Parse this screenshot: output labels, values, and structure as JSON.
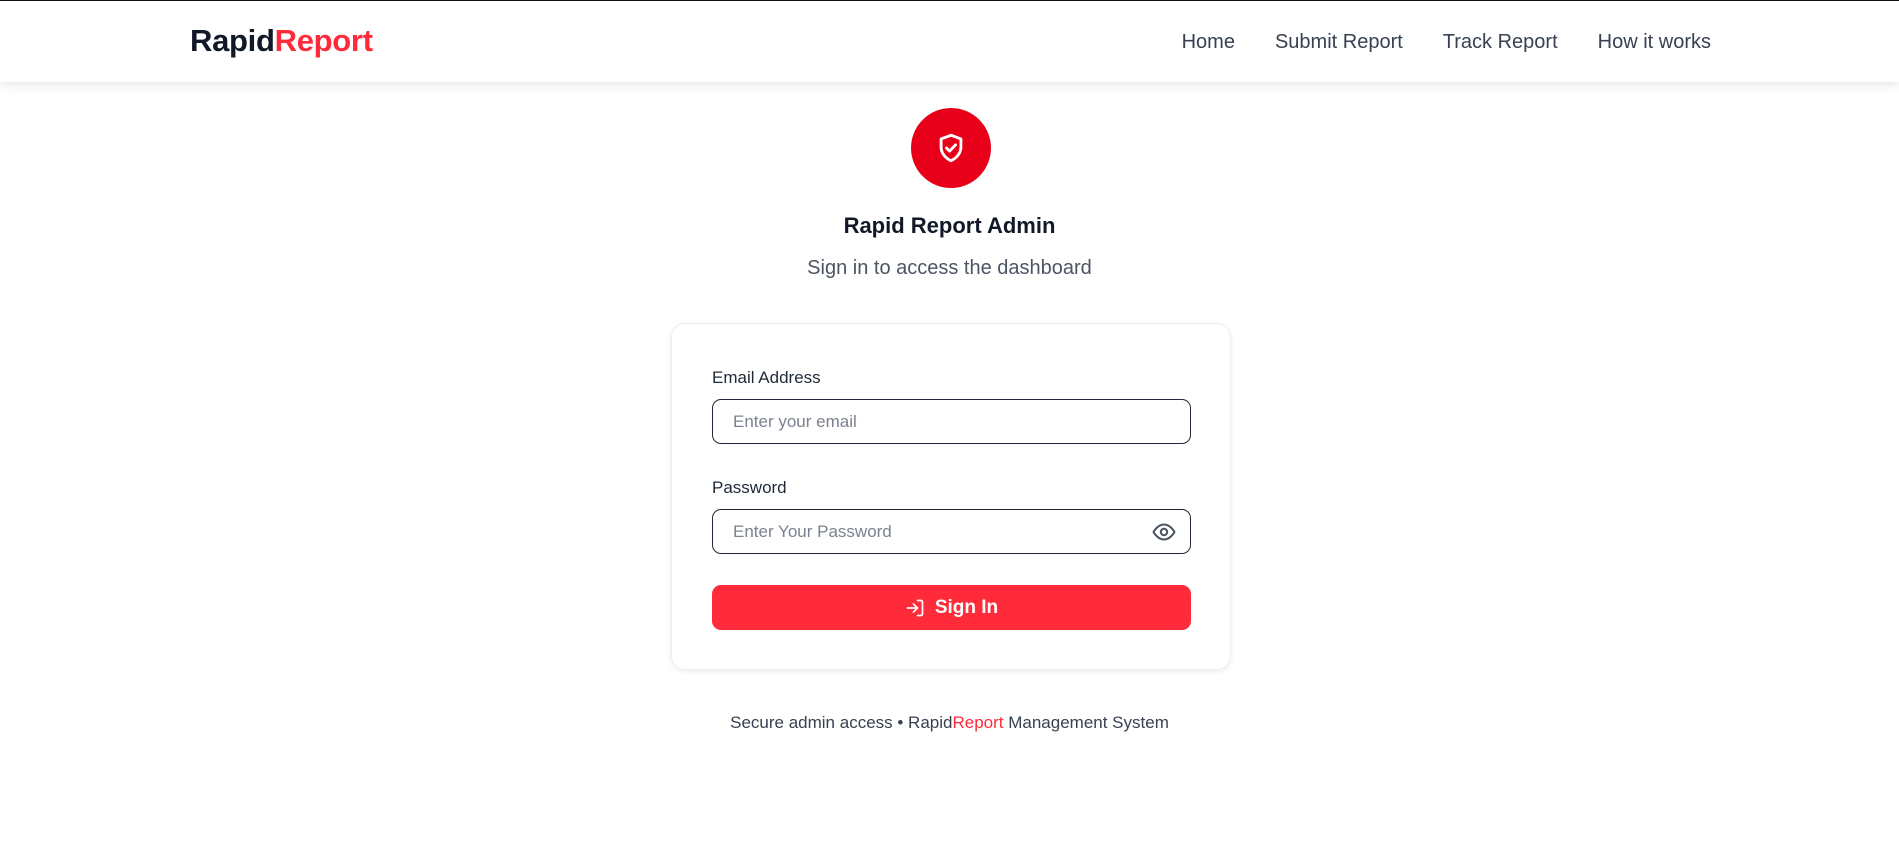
{
  "header": {
    "brand_part1": "Rapid",
    "brand_part2": "Report",
    "nav": [
      {
        "label": "Home"
      },
      {
        "label": "Submit Report"
      },
      {
        "label": "Track Report"
      },
      {
        "label": "How it works"
      }
    ]
  },
  "hero": {
    "icon": "shield-check-icon",
    "title": "Rapid Report Admin",
    "subtitle": "Sign in to access the dashboard"
  },
  "form": {
    "email_label": "Email Address",
    "email_placeholder": "Enter your email",
    "email_value": "",
    "password_label": "Password",
    "password_placeholder": "Enter Your Password",
    "password_value": "",
    "toggle_icon": "eye-icon",
    "submit_icon": "log-in-icon",
    "submit_label": "Sign In"
  },
  "footer": {
    "prefix": "Secure admin access • Rapid",
    "brand_red": "Report",
    "suffix": " Management System"
  },
  "colors": {
    "accent": "#ff2a3a",
    "shield_bg": "#e8001a",
    "text_dark": "#111827"
  }
}
